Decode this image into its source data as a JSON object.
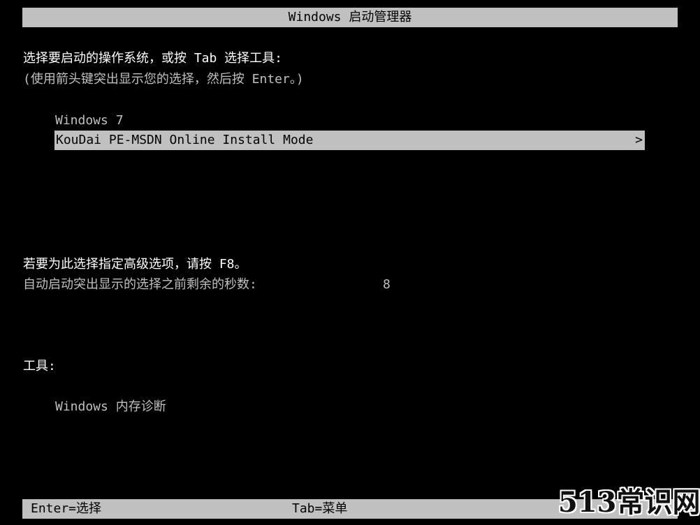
{
  "header": {
    "title": "Windows 启动管理器"
  },
  "instructions": {
    "line1": "选择要启动的操作系统，或按 Tab 选择工具:",
    "line2": "(使用箭头键突出显示您的选择，然后按 Enter。)"
  },
  "os_list": {
    "items": [
      {
        "label": "Windows 7",
        "selected": false
      },
      {
        "label": "KouDai PE-MSDN Online Install Mode",
        "selected": true,
        "arrow": ">"
      }
    ]
  },
  "advanced": {
    "f8_hint": "若要为此选择指定高级选项，请按 F8。",
    "countdown_label": "自动启动突出显示的选择之前剩余的秒数:",
    "countdown_value": "8"
  },
  "tools": {
    "heading": "工具:",
    "items": [
      {
        "label": "Windows 内存诊断"
      }
    ]
  },
  "footer": {
    "enter_hint": "Enter=选择",
    "tab_hint": "Tab=菜单"
  },
  "watermark": {
    "text": "513常识网"
  },
  "colors": {
    "background": "#000000",
    "text": "#c0c0c0",
    "highlight": "#c0c0c0",
    "highlight_text": "#000000",
    "bright_text": "#ffffff"
  }
}
